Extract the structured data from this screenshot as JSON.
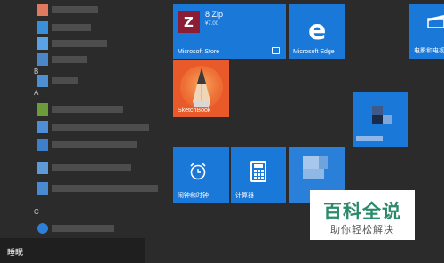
{
  "app_list": {
    "letters": [
      "B",
      "A",
      "C"
    ]
  },
  "tiles": {
    "zip": {
      "name": "8 Zip",
      "price": "¥7.00",
      "label": "Microsoft Store"
    },
    "edge": {
      "label": "Microsoft Edge"
    },
    "movies": {
      "label": "电影和电视"
    },
    "sketchbook": {
      "label": "SketchBook"
    },
    "alarms": {
      "label": "闹钟和时钟"
    },
    "calculator": {
      "label": "计算器"
    }
  },
  "watermark": {
    "title": "百科全说",
    "subtitle": "助你轻松解决"
  },
  "power_menu": {
    "label": "睡眠"
  },
  "colors": {
    "background": "#2b2b2b",
    "tile_blue": "#1a78d8",
    "zip_logo": "#8b1e35",
    "sketchbook_orange": "#e85a2a",
    "watermark_green": "#2a8a6a"
  },
  "icons": {
    "zip": "8zip-logo-icon",
    "edge": "edge-logo-icon",
    "movies": "film-clapper-icon",
    "sketchbook": "pencil-icon",
    "alarms": "alarm-clock-icon",
    "calculator": "calculator-icon"
  }
}
